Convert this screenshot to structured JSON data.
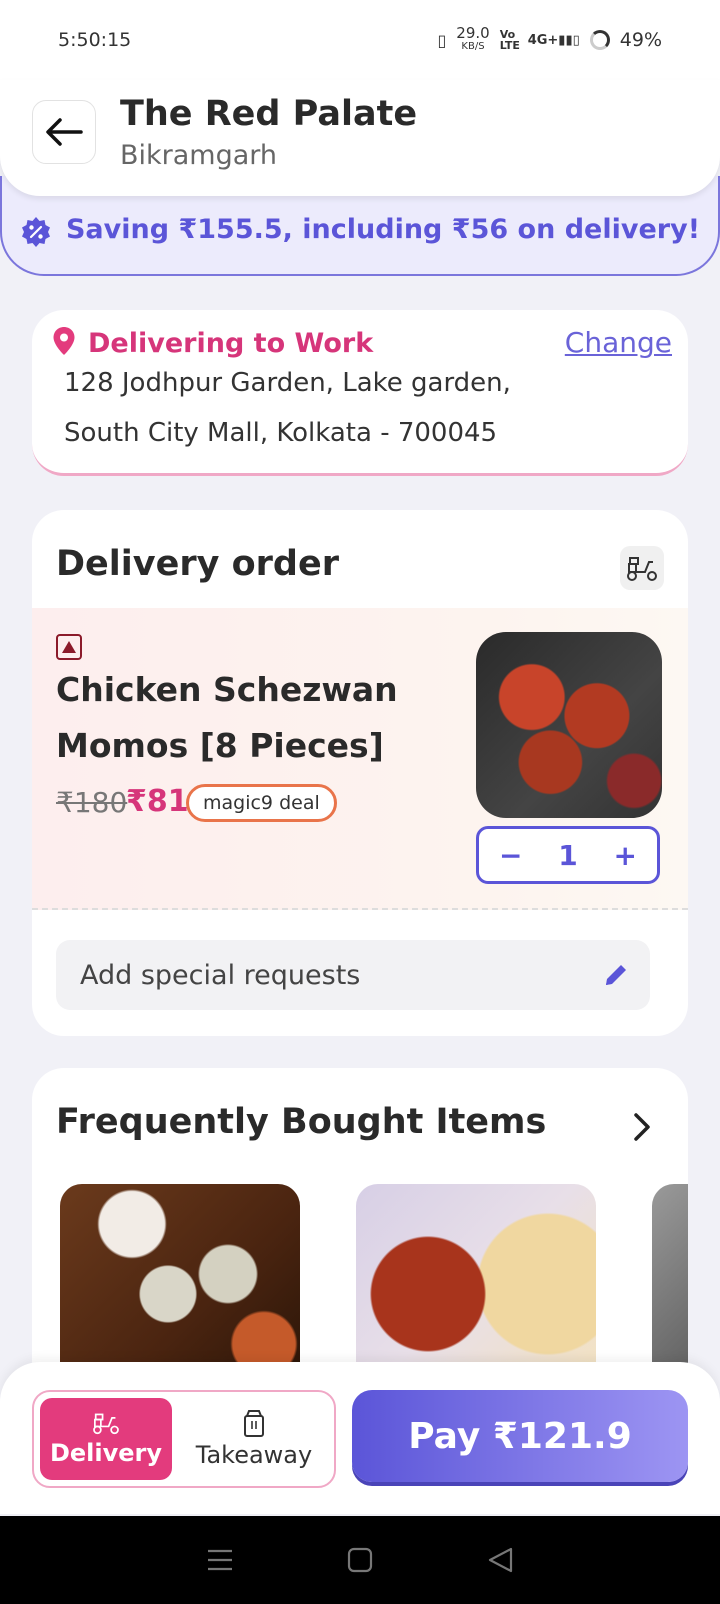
{
  "status": {
    "time": "5:50:15",
    "net_speed": "29.0",
    "net_unit": "KB/S",
    "volte": "Vo LTE",
    "signal": "4G+",
    "battery": "49%"
  },
  "header": {
    "title": "The Red Palate",
    "location": "Bikramgarh"
  },
  "banner": {
    "text": "Saving ₹155.5, including ₹56 on delivery!"
  },
  "address": {
    "title": "Delivering to Work",
    "change_label": "Change",
    "line1": "128 Jodhpur Garden, Lake garden,",
    "line2": "South City Mall, Kolkata - 700045"
  },
  "order": {
    "title": "Delivery order",
    "item": {
      "name_line1": "Chicken Schezwan",
      "name_line2": "Momos [8 Pieces]",
      "price_old": "₹180",
      "price_new": "₹81",
      "deal": "magic9 deal",
      "qty": "1",
      "minus": "−",
      "plus": "+"
    },
    "special_requests": "Add special requests"
  },
  "frequently_bought": {
    "title": "Frequently Bought Items"
  },
  "bottom": {
    "delivery_label": "Delivery",
    "takeaway_label": "Takeaway",
    "pay_label": "Pay ₹121.9"
  },
  "colors": {
    "accent": "#5b55d8",
    "pink": "#e33b7d",
    "banner_bg": "#ecebfc"
  }
}
